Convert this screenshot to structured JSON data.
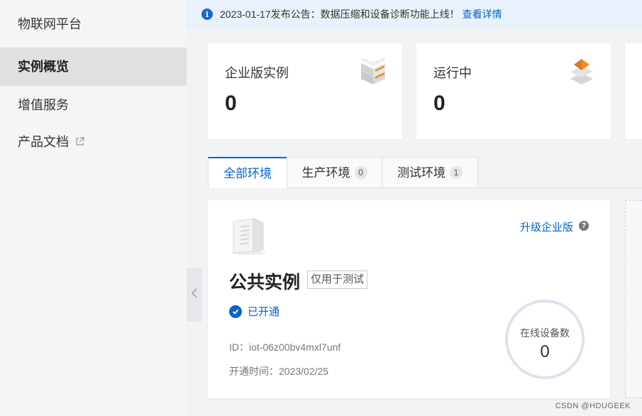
{
  "sidebar": {
    "title": "物联网平台",
    "items": [
      {
        "label": "实例概览",
        "active": true
      },
      {
        "label": "增值服务"
      },
      {
        "label": "产品文档",
        "icon": "external-link-icon"
      }
    ]
  },
  "notice": {
    "icon": "info-icon",
    "text": "2023-01-17发布公告：数据压缩和设备诊断功能上线！",
    "link": "查看详情"
  },
  "stats": [
    {
      "label": "企业版实例",
      "value": "0",
      "icon": "layers-icon"
    },
    {
      "label": "运行中",
      "value": "0",
      "icon": "running-layers-icon"
    }
  ],
  "tabs": [
    {
      "label": "全部环境",
      "active": true
    },
    {
      "label": "生产环境",
      "count": "0"
    },
    {
      "label": "测试环境",
      "count": "1"
    }
  ],
  "instance": {
    "icon": "server-icon",
    "upgrade_label": "升级企业版",
    "help_icon": "help-icon",
    "title": "公共实例",
    "tag": "仅用于测试",
    "status": "已开通",
    "id_text": "ID：iot-06z00bv4mxl7unf",
    "time_text": "开通时间：2023/02/25",
    "online_label": "在线设备数",
    "online_value": "0"
  },
  "colors": {
    "accent": "#0064c8",
    "sidebar_bg": "#f5f5f6",
    "page_bg": "#f2f3f5",
    "orange": "#f08c2d"
  },
  "watermark": "CSDN @HDUGEEK"
}
